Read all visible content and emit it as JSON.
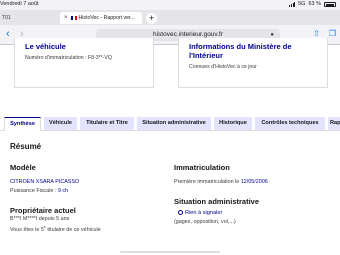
{
  "status_bar": {
    "date": "Vendredi 7 août",
    "network": "5G",
    "battery_percent": "63 %"
  },
  "browser": {
    "tabs": [
      {
        "label": "T01"
      },
      {
        "label": "HistoVec - Rapport ver..."
      }
    ],
    "new_tab": "+",
    "url": "histovec.interieur.gouv.fr",
    "nav_back": "‹",
    "nav_forward": "›"
  },
  "cards": {
    "left": {
      "title": "Le véhicule",
      "text": "Numéro d'immatriculation : F8-3**-VQ"
    },
    "right": {
      "title_line1": "Informations du Ministère de",
      "title_line2": "l'Intérieur",
      "text": "Connues d'HistoVec à ce jour"
    }
  },
  "nav_tabs": [
    "Synthèse",
    "Véhicule",
    "Titulaire et Titre",
    "Situation administrative",
    "Historique",
    "Contrôles techniques",
    "Rap"
  ],
  "summary": {
    "title": "Résumé",
    "modele_heading": "Modèle",
    "modele_value": "CITROEN XSARA PICASSO",
    "puissance_label": "Puissance Fiscale : ",
    "puissance_value": "9 ch",
    "proprietaire_heading": "Propriétaire actuel",
    "proprietaire_line": "B***I M****I depuis 5 ans",
    "titulaire_prefix": "Vous êtes le ",
    "titulaire_rank": "5",
    "titulaire_suffix": "e",
    "titulaire_end": " titulaire de ce véhicule",
    "immat_heading": "Immatriculation",
    "immat_label": "Première immatriculation le ",
    "immat_date": "12/05/2006",
    "situation_heading": "Situation administrative",
    "situation_link": "Rien à signaler",
    "situation_note": "(gages, opposition, vol,...)"
  }
}
